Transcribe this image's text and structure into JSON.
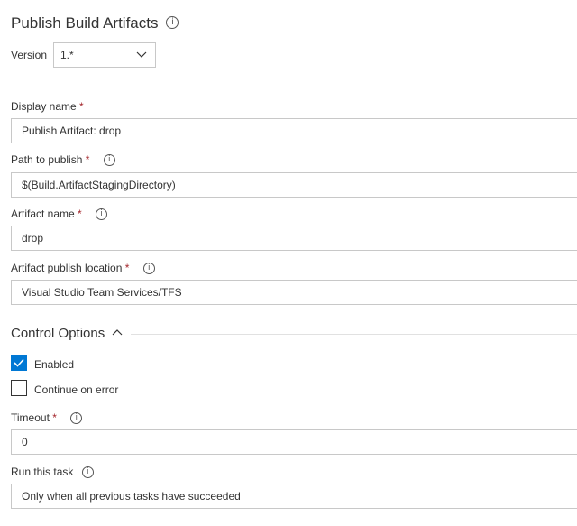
{
  "header": {
    "title": "Publish Build Artifacts",
    "info_icon": "info-icon"
  },
  "version": {
    "label": "Version",
    "value": "1.*",
    "icon": "chevron-down-icon"
  },
  "fields": [
    {
      "label": "Display name",
      "required": "*",
      "value": "Publish Artifact: drop",
      "has_info": false
    },
    {
      "label": "Path to publish",
      "required": "*",
      "value": "$(Build.ArtifactStagingDirectory)",
      "has_info": true
    },
    {
      "label": "Artifact name",
      "required": "*",
      "value": "drop",
      "has_info": true
    },
    {
      "label": "Artifact publish location",
      "required": "*",
      "value": "Visual Studio Team Services/TFS",
      "has_info": true
    }
  ],
  "control_options": {
    "title": "Control Options",
    "icon": "chevron-up-icon",
    "enabled": {
      "label": "Enabled",
      "checked": true
    },
    "continue_on_error": {
      "label": "Continue on error",
      "checked": false
    },
    "timeout": {
      "label": "Timeout",
      "required": "*",
      "value": "0"
    },
    "run_this_task": {
      "label": "Run this task",
      "value": "Only when all previous tasks have succeeded"
    }
  },
  "colors": {
    "accent": "#0078d4",
    "required": "#a4262c",
    "border": "#c8c8c8"
  }
}
